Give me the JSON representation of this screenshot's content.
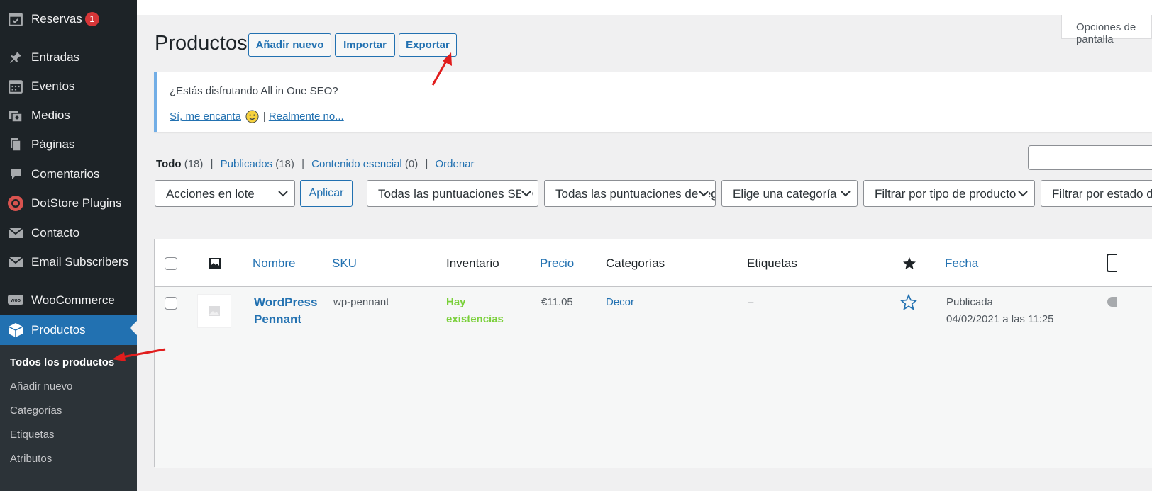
{
  "sidebar": {
    "items": [
      {
        "label": "Reservas",
        "badge": "1",
        "icon": "calendar-check-icon"
      },
      {
        "label": "Entradas",
        "icon": "pin-icon"
      },
      {
        "label": "Eventos",
        "icon": "calendar-icon"
      },
      {
        "label": "Medios",
        "icon": "media-icon"
      },
      {
        "label": "Páginas",
        "icon": "pages-icon"
      },
      {
        "label": "Comentarios",
        "icon": "comment-icon"
      },
      {
        "label": "DotStore Plugins",
        "icon": "dotstore-icon"
      },
      {
        "label": "Contacto",
        "icon": "mail-icon"
      },
      {
        "label": "Email Subscribers",
        "icon": "mail-icon"
      },
      {
        "label": "WooCommerce",
        "icon": "woocommerce-icon"
      },
      {
        "label": "Productos",
        "icon": "box-icon"
      }
    ],
    "submenu": [
      "Todos los productos",
      "Añadir nuevo",
      "Categorías",
      "Etiquetas",
      "Atributos"
    ]
  },
  "header": {
    "screen_options": "Opciones de pantalla",
    "title": "Productos",
    "buttons": [
      "Añadir nuevo",
      "Importar",
      "Exportar"
    ]
  },
  "notice": {
    "question": "¿Estás disfrutando All in One SEO?",
    "yes_link": "Sí, me encanta",
    "separator": "|",
    "no_link": "Realmente no..."
  },
  "views": [
    {
      "label": "Todo",
      "count": "(18)"
    },
    {
      "label": "Publicados",
      "count": "(18)"
    },
    {
      "label": "Contenido esencial",
      "count": "(0)"
    },
    {
      "label": "Ordenar",
      "count": ""
    }
  ],
  "filters": {
    "bulk": "Acciones en lote",
    "apply": "Aplicar",
    "seo": "Todas las puntuaciones SEO",
    "readability": "Todas las puntuaciones de legibilidad",
    "category": "Elige una categoría",
    "product_type": "Filtrar por tipo de producto",
    "stock": "Filtrar por estado de inventario"
  },
  "table": {
    "columns": [
      "Nombre",
      "SKU",
      "Inventario",
      "Precio",
      "Categorías",
      "Etiquetas",
      "Fecha"
    ],
    "rows": [
      {
        "name": "WordPress Pennant",
        "sku": "wp-pennant",
        "stock": "Hay existencias",
        "price": "€11.05",
        "category": "Decor",
        "tags": "–",
        "date_status": "Publicada",
        "date": "04/02/2021 a las 11:25"
      }
    ]
  },
  "colors": {
    "sidebar_bg": "#1d2327",
    "accent": "#2271b1",
    "in_stock": "#7ad03a",
    "arrow": "#e11d1d"
  }
}
